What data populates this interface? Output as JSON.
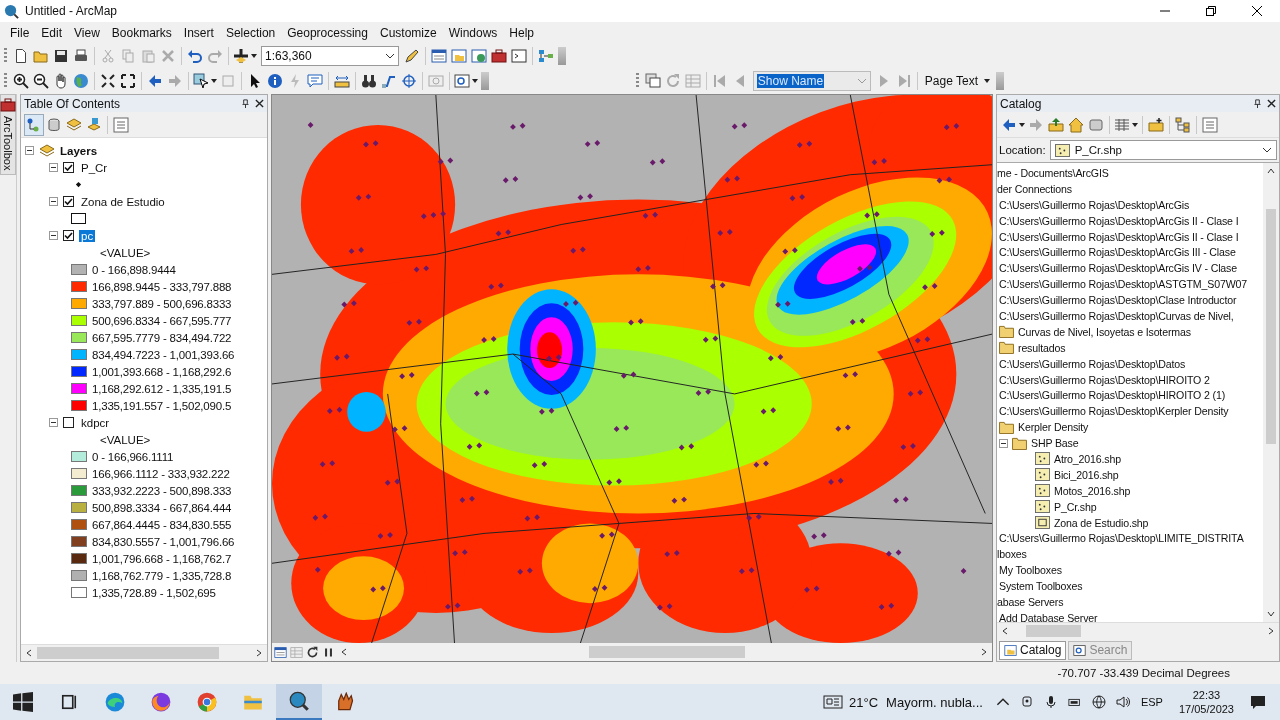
{
  "window": {
    "title": "Untitled - ArcMap"
  },
  "menu": [
    "File",
    "Edit",
    "View",
    "Bookmarks",
    "Insert",
    "Selection",
    "Geoprocessing",
    "Customize",
    "Windows",
    "Help"
  ],
  "toolbar": {
    "scale": "1:63,360",
    "page_name": "Show Name",
    "page_text": "Page Text"
  },
  "toolbox_tab": "ArcToolbox",
  "toc": {
    "title": "Table Of Contents",
    "root": "Layers",
    "layers": [
      {
        "name": "P_Cr",
        "kind": "point",
        "checked": true,
        "expanded": true,
        "selected": false
      },
      {
        "name": "Zona de Estudio",
        "kind": "polygon",
        "checked": true,
        "expanded": true,
        "selected": false
      },
      {
        "name": "pc",
        "kind": "raster",
        "checked": true,
        "expanded": true,
        "selected": true,
        "field": "<VALUE>",
        "classes": [
          {
            "label": "0 - 166,898.9444",
            "color": "#b2b2b2"
          },
          {
            "label": "166,898.9445 - 333,797.888",
            "color": "#ff2a00"
          },
          {
            "label": "333,797.889 - 500,696.8333",
            "color": "#ffaa00"
          },
          {
            "label": "500,696.8334 - 667,595.777",
            "color": "#aaff00"
          },
          {
            "label": "667,595.7779 - 834,494.722",
            "color": "#98e85a"
          },
          {
            "label": "834,494.7223 - 1,001,393.66",
            "color": "#00b4ff"
          },
          {
            "label": "1,001,393.668 - 1,168,292.6",
            "color": "#0028ff"
          },
          {
            "label": "1,168,292.612 - 1,335,191.5",
            "color": "#ff00ff"
          },
          {
            "label": "1,335,191.557 - 1,502,090.5",
            "color": "#ff0000"
          }
        ]
      },
      {
        "name": "kdpcr",
        "kind": "raster",
        "checked": false,
        "expanded": true,
        "selected": false,
        "field": "<VALUE>",
        "classes": [
          {
            "label": "0 - 166,966.1111",
            "color": "#b4ecdc"
          },
          {
            "label": "166,966.1112 - 333,932.222",
            "color": "#f4ecd0"
          },
          {
            "label": "333,932.2223 - 500,898.333",
            "color": "#2a9a3a"
          },
          {
            "label": "500,898.3334 - 667,864.444",
            "color": "#b8b040"
          },
          {
            "label": "667,864.4445 - 834,830.555",
            "color": "#b05010"
          },
          {
            "label": "834,830.5557 - 1,001,796.66",
            "color": "#804020"
          },
          {
            "label": "1,001,796.668 - 1,168,762.7",
            "color": "#5a2a10"
          },
          {
            "label": "1,168,762.779 - 1,335,728.8",
            "color": "#b0b0b0"
          },
          {
            "label": "1,335,728.89 - 1,502,695",
            "color": "#ffffff"
          }
        ]
      }
    ]
  },
  "catalog": {
    "title": "Catalog",
    "location_label": "Location:",
    "location": "P_Cr.shp",
    "items": [
      {
        "label": "me - Documents\\ArcGIS",
        "kind": "text"
      },
      {
        "label": "der Connections",
        "kind": "text"
      },
      {
        "label": "C:\\Users\\Guillermo Rojas\\Desktop\\ArcGis",
        "kind": "connection"
      },
      {
        "label": "C:\\Users\\Guillermo Rojas\\Desktop\\ArcGis II - Clase I",
        "kind": "connection"
      },
      {
        "label": "C:\\Users\\Guillermo Rojas\\Desktop\\ArcGis II - Clase I",
        "kind": "connection"
      },
      {
        "label": "C:\\Users\\Guillermo Rojas\\Desktop\\ArcGis III - Clase",
        "kind": "connection"
      },
      {
        "label": "C:\\Users\\Guillermo Rojas\\Desktop\\ArcGis IV - Clase",
        "kind": "connection"
      },
      {
        "label": "C:\\Users\\Guillermo Rojas\\Desktop\\ASTGTM_S07W07",
        "kind": "connection"
      },
      {
        "label": "C:\\Users\\Guillermo Rojas\\Desktop\\Clase Introductor",
        "kind": "connection"
      },
      {
        "label": "C:\\Users\\Guillermo Rojas\\Desktop\\Curvas de Nivel,",
        "kind": "connection"
      },
      {
        "label": "Curvas de Nivel, Isoyetas e Isotermas",
        "kind": "folder"
      },
      {
        "label": "resultados",
        "kind": "folder"
      },
      {
        "label": "C:\\Users\\Guillermo Rojas\\Desktop\\Datos",
        "kind": "connection"
      },
      {
        "label": "C:\\Users\\Guillermo Rojas\\Desktop\\HIROITO 2",
        "kind": "connection"
      },
      {
        "label": "C:\\Users\\Guillermo Rojas\\Desktop\\HIROITO 2 (1)",
        "kind": "connection"
      },
      {
        "label": "C:\\Users\\Guillermo Rojas\\Desktop\\Kerpler Density",
        "kind": "connection"
      },
      {
        "label": "Kerpler Density",
        "kind": "folder"
      },
      {
        "label": "SHP Base",
        "kind": "folder",
        "expanded": true,
        "children": [
          {
            "label": "Atro_2016.shp",
            "kind": "point-shp"
          },
          {
            "label": "Bici_2016.shp",
            "kind": "point-shp"
          },
          {
            "label": "Motos_2016.shp",
            "kind": "point-shp"
          },
          {
            "label": "P_Cr.shp",
            "kind": "point-shp"
          },
          {
            "label": "Zona de Estudio.shp",
            "kind": "polygon-shp"
          }
        ]
      },
      {
        "label": "C:\\Users\\Guillermo Rojas\\Desktop\\LIMITE_DISTRITA",
        "kind": "connection"
      },
      {
        "label": "lboxes",
        "kind": "text"
      },
      {
        "label": "My Toolboxes",
        "kind": "connection"
      },
      {
        "label": "System Toolboxes",
        "kind": "connection"
      },
      {
        "label": "abase Servers",
        "kind": "text"
      },
      {
        "label": "Add Database Server",
        "kind": "connection"
      }
    ],
    "tabs": [
      {
        "label": "Catalog",
        "selected": true
      },
      {
        "label": "Search",
        "selected": false
      }
    ]
  },
  "status_bar": {
    "coordinates": "-70.707  -33.439 Decimal Degrees"
  },
  "taskbar": {
    "weather": "21°C",
    "forecast": "Mayorm. nubla...",
    "language": "ESP",
    "time": "22:33",
    "date": "17/05/2023"
  }
}
